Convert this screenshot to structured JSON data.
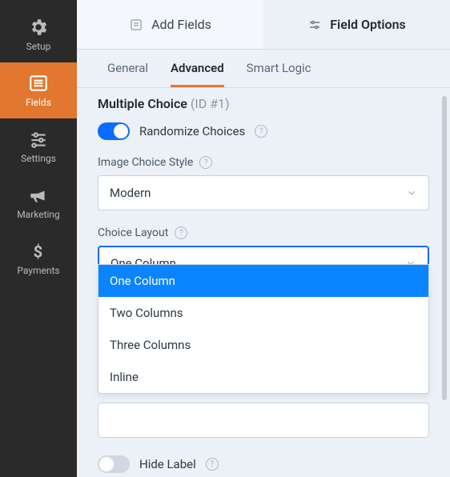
{
  "sidebar": {
    "items": [
      {
        "label": "Setup"
      },
      {
        "label": "Fields"
      },
      {
        "label": "Settings"
      },
      {
        "label": "Marketing"
      },
      {
        "label": "Payments"
      }
    ]
  },
  "top_tabs": {
    "add_fields": "Add Fields",
    "field_options": "Field Options"
  },
  "sub_tabs": {
    "general": "General",
    "advanced": "Advanced",
    "smart_logic": "Smart Logic"
  },
  "section": {
    "title": "Multiple Choice",
    "id_label": "(ID #1)"
  },
  "toggles": {
    "randomize": "Randomize Choices",
    "hide_label": "Hide Label"
  },
  "image_style": {
    "label": "Image Choice Style",
    "value": "Modern"
  },
  "choice_layout": {
    "label": "Choice Layout",
    "value": "One Column",
    "options": [
      "One Column",
      "Two Columns",
      "Three Columns",
      "Inline"
    ]
  }
}
